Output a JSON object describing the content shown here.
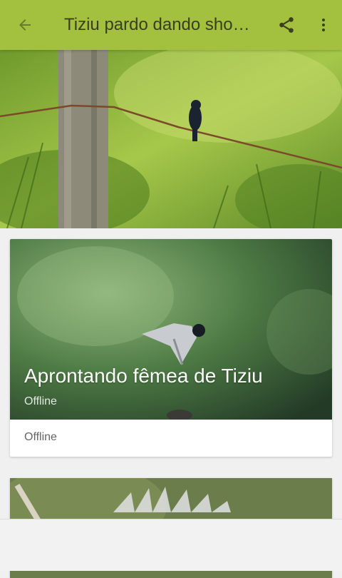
{
  "appbar": {
    "title": "Tiziu pardo dando sho…",
    "back_icon": "arrow-back-icon",
    "share_icon": "share-icon",
    "more_icon": "more-vert-icon",
    "color": "#a4c03f"
  },
  "hero": {
    "image": "photo of black bird perched on barbed wire fence"
  },
  "cards": [
    {
      "title": "Aprontando fêmea de Tiziu",
      "subtitle": "Offline",
      "footer": "Offline"
    }
  ]
}
